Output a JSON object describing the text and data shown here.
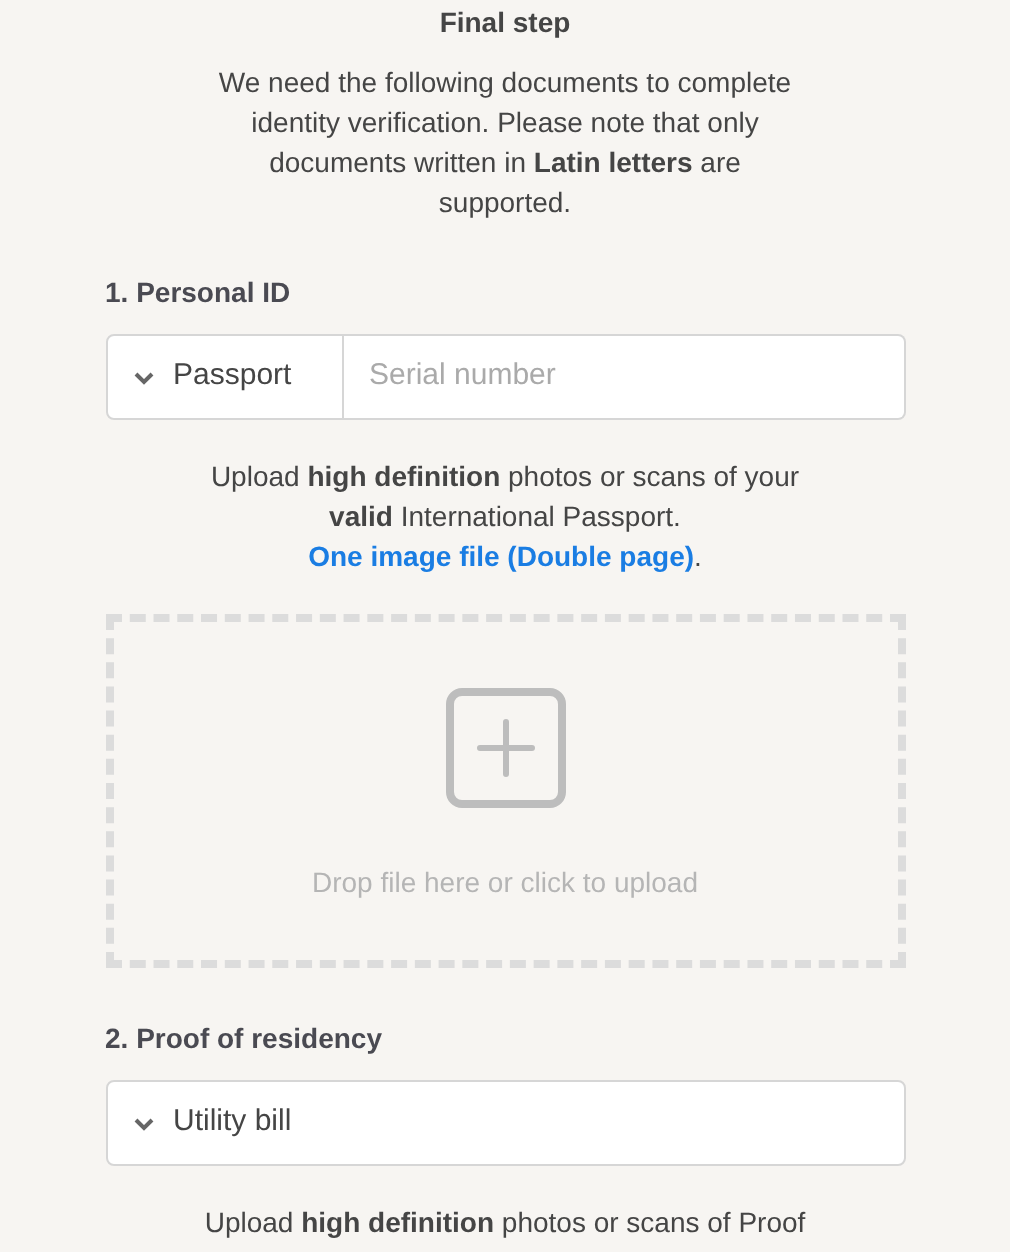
{
  "title": "Final step",
  "intro": "We need the following documents to complete identity verification. Please note that only documents written in **Latin letters** are supported.",
  "sections": [
    {
      "kind": "id",
      "heading": "1. Personal ID",
      "select": "Passport",
      "field": {
        "placeholder": "Serial number"
      },
      "instructions": "Upload **high definition** photos or scans of your **valid** International Passport.",
      "note": "One image file (Double page)",
      "note_end": ".",
      "dropzone": "Drop file here or click to upload"
    },
    {
      "kind": "residency",
      "heading": "2. Proof of residency",
      "select": "Utility bill",
      "instructions": "Upload **high definition** photos or scans of Proof"
    }
  ]
}
